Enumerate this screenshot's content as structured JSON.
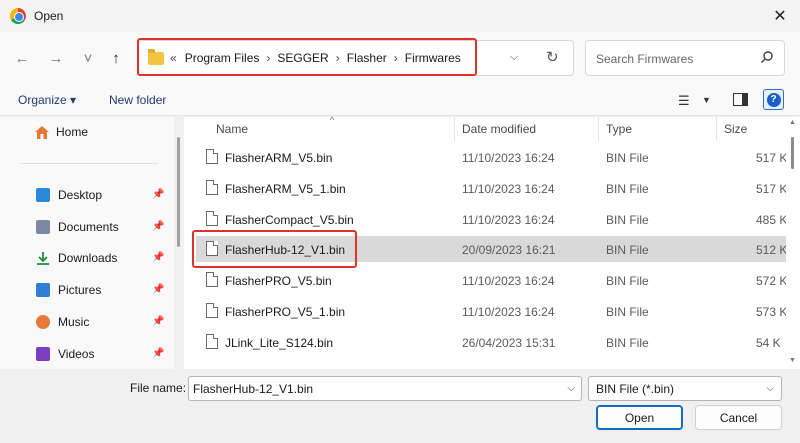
{
  "window": {
    "title": "Open",
    "close_glyph": "✕"
  },
  "nav": {
    "back_glyph": "←",
    "forward_glyph": "→",
    "recent_glyph": "˅",
    "up_glyph": "↑",
    "breadcrumb_prefix": "«",
    "breadcrumb": [
      "Program Files",
      "SEGGER",
      "Flasher",
      "Firmwares"
    ],
    "breadcrumb_sep": "›",
    "dropdown_glyph": "⌵",
    "refresh_glyph": "↻",
    "search_placeholder": "Search Firmwares"
  },
  "toolbar": {
    "organize_label": "Organize ▾",
    "new_folder_label": "New folder",
    "view_glyph": "☰",
    "view_caret": "▼",
    "help_glyph": "?"
  },
  "sidebar": {
    "home": "Home",
    "pin_glyph": "📌",
    "items": [
      {
        "label": "Desktop",
        "color": "#2b88d8"
      },
      {
        "label": "Documents",
        "color": "#7a8aa0"
      },
      {
        "label": "Downloads",
        "color": "#1e8e3e"
      },
      {
        "label": "Pictures",
        "color": "#2f7fd6"
      },
      {
        "label": "Music",
        "color": "#e8773a"
      },
      {
        "label": "Videos",
        "color": "#7b3fc4"
      }
    ]
  },
  "columns": {
    "name": "Name",
    "date": "Date modified",
    "type": "Type",
    "size": "Size",
    "sort_glyph": "^"
  },
  "files": [
    {
      "name": "FlasherARM_V5.bin",
      "date": "11/10/2023 16:24",
      "type": "BIN File",
      "size": "517 K"
    },
    {
      "name": "FlasherARM_V5_1.bin",
      "date": "11/10/2023 16:24",
      "type": "BIN File",
      "size": "517 K"
    },
    {
      "name": "FlasherCompact_V5.bin",
      "date": "11/10/2023 16:24",
      "type": "BIN File",
      "size": "485 K"
    },
    {
      "name": "FlasherHub-12_V1.bin",
      "date": "20/09/2023 16:21",
      "type": "BIN File",
      "size": "512 K",
      "selected": true
    },
    {
      "name": "FlasherPRO_V5.bin",
      "date": "11/10/2023 16:24",
      "type": "BIN File",
      "size": "572 K"
    },
    {
      "name": "FlasherPRO_V5_1.bin",
      "date": "11/10/2023 16:24",
      "type": "BIN File",
      "size": "573 K"
    },
    {
      "name": "JLink_Lite_S124.bin",
      "date": "26/04/2023 15:31",
      "type": "BIN File",
      "size": "54 K"
    }
  ],
  "footer": {
    "filename_label": "File name:",
    "filename_value": "FlasherHub-12_V1.bin",
    "filetype_value": "BIN File (*.bin)",
    "caret_glyph": "⌵",
    "open_label": "Open",
    "cancel_label": "Cancel"
  },
  "scroll_glyphs": {
    "up": "▲",
    "down": "▼"
  },
  "highlight_color": "#e03131"
}
